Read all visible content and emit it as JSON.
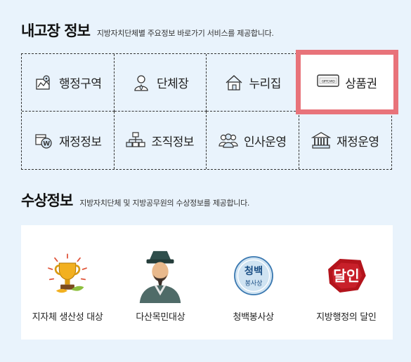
{
  "info_section": {
    "title": "내고장 정보",
    "subtitle": "지방자치단체별 주요정보 바로가기 서비스를 제공합니다.",
    "items": [
      {
        "label": "행정구역",
        "icon": "map-icon"
      },
      {
        "label": "단체장",
        "icon": "person-icon"
      },
      {
        "label": "누리집",
        "icon": "house-icon"
      },
      {
        "label": "상품권",
        "icon": "gift-card-icon",
        "card_text": "GIFTCARD"
      },
      {
        "label": "재정정보",
        "icon": "finance-icon"
      },
      {
        "label": "조직정보",
        "icon": "org-chart-icon"
      },
      {
        "label": "인사운영",
        "icon": "people-icon"
      },
      {
        "label": "재정운영",
        "icon": "building-icon"
      }
    ]
  },
  "award_section": {
    "title": "수상정보",
    "subtitle": "지방자치단체 및 지방공무원의 수상정보를 제공합니다.",
    "items": [
      {
        "label": "지자체 생산성 대상",
        "icon": "trophy-icon"
      },
      {
        "label": "다산목민대상",
        "icon": "portrait-icon"
      },
      {
        "label": "청백봉사상",
        "icon": "seal-icon",
        "seal_text_top": "청백",
        "seal_text_bottom": "봉사상"
      },
      {
        "label": "지방행정의 달인",
        "icon": "badge-icon",
        "badge_text": "달인"
      }
    ]
  },
  "colors": {
    "background": "#e9f3fc",
    "highlight": "#e8737a",
    "text": "#222222"
  }
}
